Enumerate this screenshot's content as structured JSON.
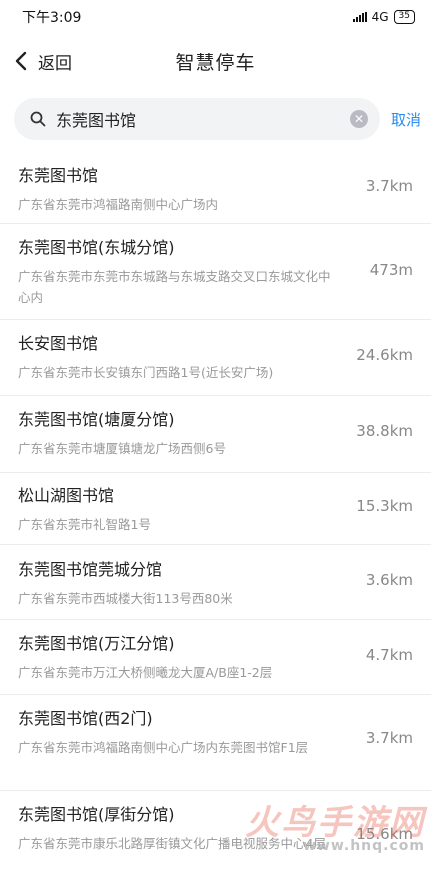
{
  "status_bar": {
    "time": "下午3:09",
    "network": "4G",
    "battery": "35"
  },
  "nav": {
    "back_label": "返回",
    "title": "智慧停车"
  },
  "search": {
    "value": "东莞图书馆",
    "cancel_label": "取消"
  },
  "results": [
    {
      "name": "东莞图书馆",
      "address": "广东省东莞市鸿福路南侧中心广场内",
      "distance": "3.7km"
    },
    {
      "name": "东莞图书馆(东城分馆)",
      "address": "广东省东莞市东莞市东城路与东城支路交叉口东城文化中心内",
      "distance": "473m"
    },
    {
      "name": "长安图书馆",
      "address": "广东省东莞市长安镇东门西路1号(近长安广场)",
      "distance": "24.6km"
    },
    {
      "name": "东莞图书馆(塘厦分馆)",
      "address": "广东省东莞市塘厦镇塘龙广场西侧6号",
      "distance": "38.8km"
    },
    {
      "name": "松山湖图书馆",
      "address": "广东省东莞市礼智路1号",
      "distance": "15.3km"
    },
    {
      "name": "东莞图书馆莞城分馆",
      "address": "广东省东莞市西城楼大街113号西80米",
      "distance": "3.6km"
    },
    {
      "name": "东莞图书馆(万江分馆)",
      "address": "广东省东莞市万江大桥侧曦龙大厦A/B座1-2层",
      "distance": "4.7km"
    },
    {
      "name": "东莞图书馆(西2门)",
      "address": "广东省东莞市鸿福路南侧中心广场内东莞图书馆F1层",
      "distance": "3.7km"
    },
    {
      "name": "东莞图书馆(厚街分馆)",
      "address": "广东省东莞市康乐北路厚街镇文化广播电视服务中心4层",
      "distance": "15.6km"
    }
  ],
  "watermark": {
    "text": "火鸟手游网",
    "url": "www.hnq.com"
  }
}
